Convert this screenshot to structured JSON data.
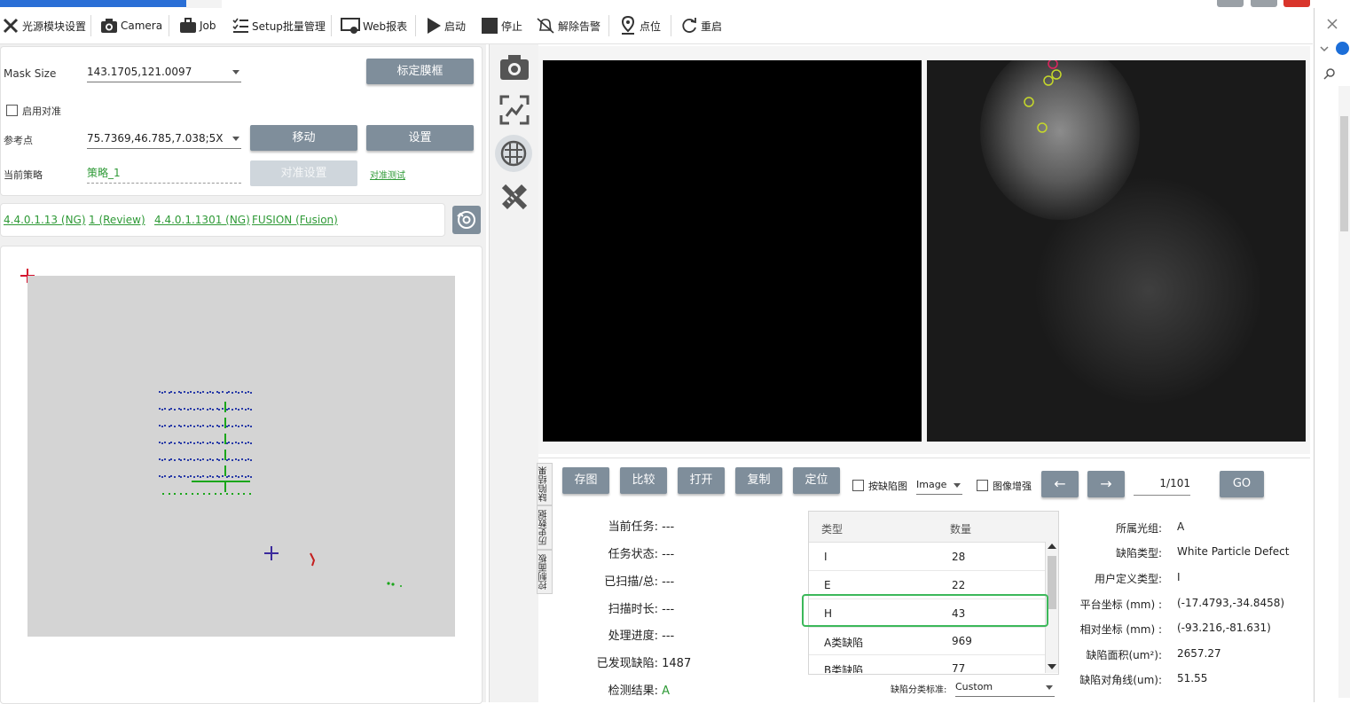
{
  "toolbar": {
    "items": [
      {
        "label": "光源模块设置",
        "icon": "tools-icon"
      },
      {
        "label": "Camera",
        "icon": "camera-icon"
      },
      {
        "label": "Job",
        "icon": "briefcase-icon"
      },
      {
        "label": "Setup批量管理",
        "icon": "list-icon"
      },
      {
        "label": "Web报表",
        "icon": "monitor-icon"
      },
      {
        "label": "启动",
        "icon": "play-icon"
      },
      {
        "label": "停止",
        "icon": "stop-icon"
      },
      {
        "label": "解除告警",
        "icon": "bell-off-icon"
      },
      {
        "label": "点位",
        "icon": "location-pin-icon"
      },
      {
        "label": "重启",
        "icon": "restart-icon"
      }
    ]
  },
  "left": {
    "mask_size_label": "Mask Size",
    "mask_size_value": "143.1705,121.0097",
    "calibrate_button": "标定膜框",
    "enable_align_label": "启用对准",
    "ref_point_label": "参考点",
    "ref_point_value": "75.7369,46.785,7.038;5X",
    "move_button": "移动",
    "set_button": "设置",
    "strategy_label": "当前策略",
    "strategy_value": "策略_1",
    "align_settings_button": "对准设置",
    "align_test_link": "对准测试",
    "versions": [
      "4.4.0.1.13 (NG)",
      "1 (Review)",
      "4.4.0.1.1301 (NG)",
      "FUSION (Fusion)"
    ]
  },
  "bottom": {
    "buttons": [
      "存图",
      "比较",
      "打开",
      "复制",
      "定位"
    ],
    "by_defect_label": "按缺陷图",
    "image_select": "Image",
    "enhance_label": "图像增强",
    "page_indicator": "1/101",
    "go_button": "GO",
    "prev_arrow": "←",
    "next_arrow": "→",
    "side_tabs": [
      "缺陷结果",
      "历史数据",
      "控制面板"
    ],
    "status": [
      {
        "key": "当前任务:",
        "value": "---"
      },
      {
        "key": "任务状态:",
        "value": "---"
      },
      {
        "key": "已扫描/总:",
        "value": "---"
      },
      {
        "key": "扫描时长:",
        "value": "---"
      },
      {
        "key": "处理进度:",
        "value": "---"
      },
      {
        "key": "已发现缺陷:",
        "value": "1487"
      },
      {
        "key": "检测结果:",
        "value": "A"
      }
    ],
    "table": {
      "headers": [
        "类型",
        "数量"
      ],
      "rows": [
        {
          "type": "I",
          "count": "28"
        },
        {
          "type": "E",
          "count": "22"
        },
        {
          "type": "H",
          "count": "43"
        },
        {
          "type": "A类缺陷",
          "count": "969"
        },
        {
          "type": "B类缺陷",
          "count": "77"
        }
      ]
    },
    "classify_label": "缺陷分类标准:",
    "classify_value": "Custom",
    "details": [
      {
        "key": "所属光组:",
        "value": "A"
      },
      {
        "key": "缺陷类型:",
        "value": "White Particle Defect"
      },
      {
        "key": "用户定义类型:",
        "value": "I"
      },
      {
        "key": "平台坐标 (mm) :",
        "value": "(-17.4793,-34.8458)"
      },
      {
        "key": "相对坐标 (mm) :",
        "value": "(-93.216,-81.631)"
      },
      {
        "key": "缺陷面积(um²):",
        "value": "2657.27"
      },
      {
        "key": "缺陷对角线(um):",
        "value": "51.55"
      }
    ]
  },
  "colors": {
    "accent_green": "#2f9a37",
    "button_gray": "#7f8e9b",
    "highlight_box": "#3cb85a"
  }
}
